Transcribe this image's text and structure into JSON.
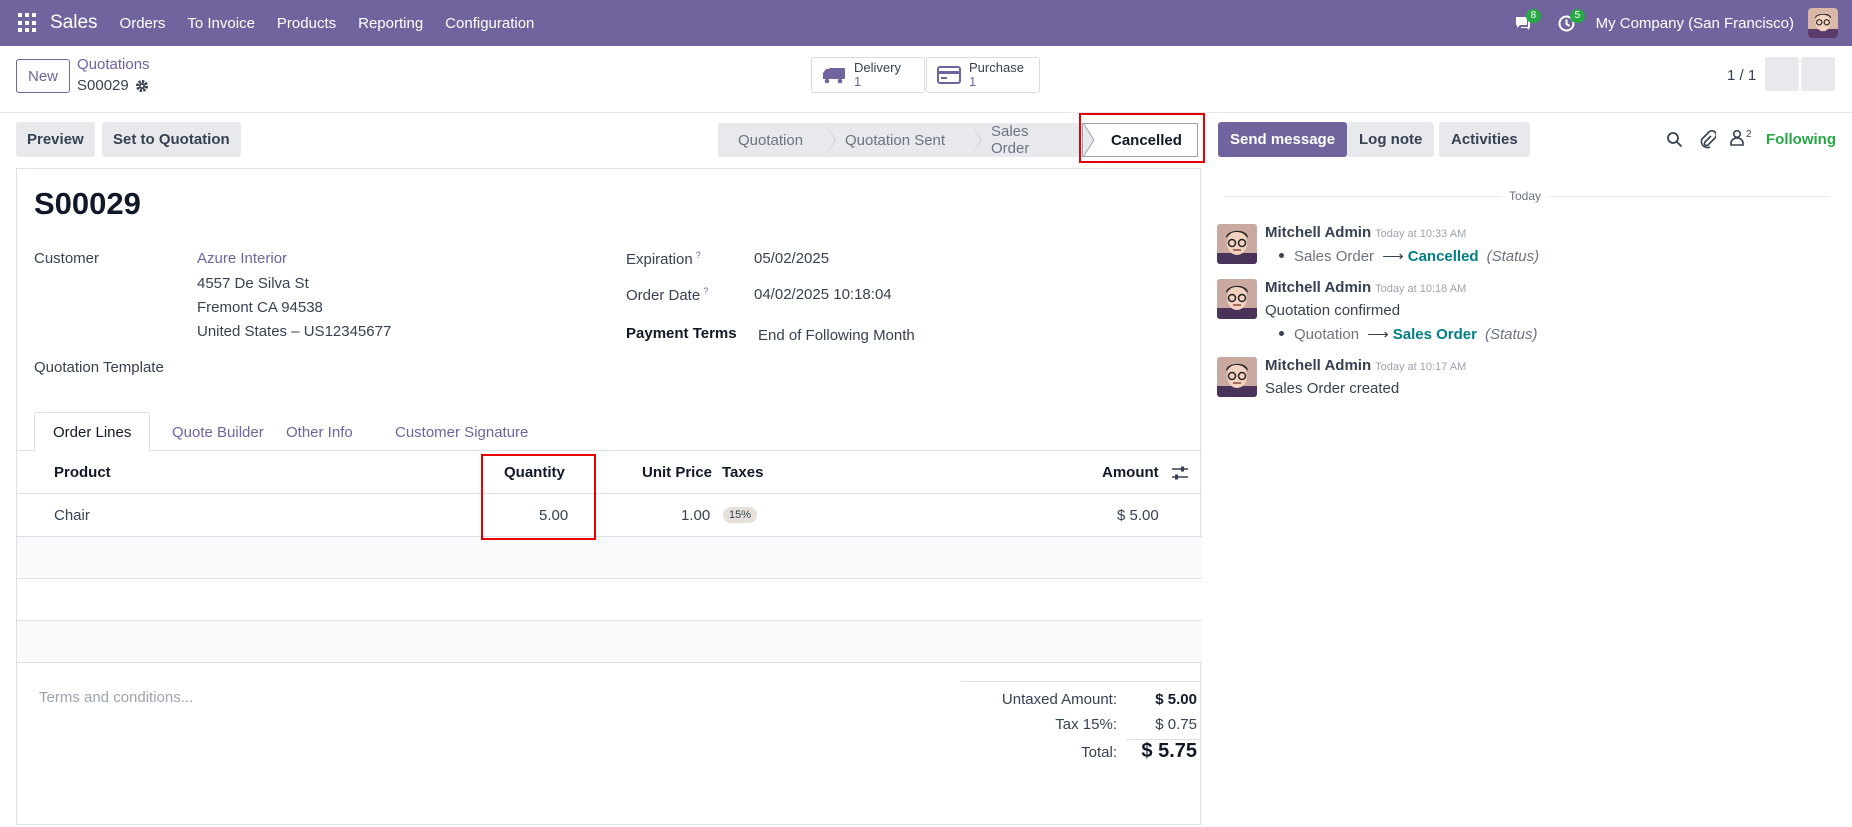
{
  "navbar": {
    "app_name": "Sales",
    "menu": [
      "Orders",
      "To Invoice",
      "Products",
      "Reporting",
      "Configuration"
    ],
    "messages_count": "8",
    "activities_count": "5",
    "company": "My Company (San Francisco)",
    "brand_color": "#71639e"
  },
  "control_panel": {
    "new_label": "New",
    "breadcrumb_parent": "Quotations",
    "breadcrumb_current": "S00029",
    "smart_buttons": [
      {
        "label": "Delivery",
        "count": "1",
        "icon": "truck-icon"
      },
      {
        "label": "Purchase",
        "count": "1",
        "icon": "credit-card-icon"
      }
    ],
    "pager": "1 / 1"
  },
  "actions": {
    "preview": "Preview",
    "set_to_quotation": "Set to Quotation"
  },
  "statusbar": {
    "stages": [
      "Quotation",
      "Quotation Sent",
      "Sales Order",
      "Cancelled"
    ],
    "active": "Cancelled"
  },
  "form": {
    "name": "S00029",
    "customer_label": "Customer",
    "customer_name": "Azure Interior",
    "customer_address": [
      "4557 De Silva St",
      "Fremont CA 94538",
      "United States – US12345677"
    ],
    "template_label": "Quotation Template",
    "expiration_label": "Expiration",
    "expiration_value": "05/02/2025",
    "order_date_label": "Order Date",
    "order_date_value": "04/02/2025 10:18:04",
    "payment_terms_label": "Payment Terms",
    "payment_terms_value": "End of Following Month",
    "help_mark": "?"
  },
  "tabs": [
    "Order Lines",
    "Quote Builder",
    "Other Info",
    "Customer Signature"
  ],
  "order_lines": {
    "headers": {
      "product": "Product",
      "quantity": "Quantity",
      "unit_price": "Unit Price",
      "taxes": "Taxes",
      "amount": "Amount"
    },
    "rows": [
      {
        "product": "Chair",
        "quantity": "5.00",
        "unit_price": "1.00",
        "taxes": "15%",
        "amount": "$ 5.00"
      }
    ]
  },
  "footer": {
    "terms_placeholder": "Terms and conditions...",
    "untaxed_label": "Untaxed Amount:",
    "untaxed_value": "$ 5.00",
    "tax_label": "Tax 15%:",
    "tax_value": "$ 0.75",
    "total_label": "Total:",
    "total_value": "$ 5.75"
  },
  "chatter": {
    "send_message": "Send message",
    "log_note": "Log note",
    "activities": "Activities",
    "followers_count": "2",
    "following": "Following",
    "date_separator": "Today",
    "messages": [
      {
        "author": "Mitchell Admin",
        "time": "Today at 10:33 AM",
        "tracking": {
          "old": "Sales Order",
          "new": "Cancelled",
          "field": "(Status)"
        }
      },
      {
        "author": "Mitchell Admin",
        "time": "Today at 10:18 AM",
        "body": "Quotation confirmed",
        "tracking": {
          "old": "Quotation",
          "new": "Sales Order",
          "field": "(Status)"
        }
      },
      {
        "author": "Mitchell Admin",
        "time": "Today at 10:17 AM",
        "body": "Sales Order created"
      }
    ]
  }
}
